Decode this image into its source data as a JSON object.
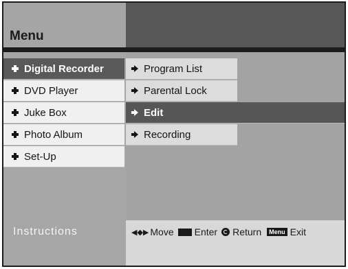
{
  "header": {
    "title": "Menu"
  },
  "main_menu": {
    "items": [
      {
        "label": "Digital Recorder",
        "selected": true
      },
      {
        "label": "DVD Player",
        "selected": false
      },
      {
        "label": "Juke Box",
        "selected": false
      },
      {
        "label": "Photo Album",
        "selected": false
      },
      {
        "label": "Set-Up",
        "selected": false
      }
    ]
  },
  "sub_menu": {
    "items": [
      {
        "label": "Program List",
        "selected": false
      },
      {
        "label": "Parental Lock",
        "selected": false
      },
      {
        "label": "Edit",
        "selected": true
      },
      {
        "label": "Recording",
        "selected": false
      }
    ]
  },
  "footer": {
    "title": "Instructions",
    "move_label": "Move",
    "enter_label": "Enter",
    "return_label": "Return",
    "menu_key_label": "Menu",
    "exit_label": "Exit"
  },
  "colors": {
    "header_light": "#a5a5a5",
    "header_dark": "#575757",
    "selected_bg": "#595959",
    "item_bg": "#f0f0f0",
    "subitem_bg": "#dcdcdc"
  },
  "icons": {
    "main_item": "cross-icon",
    "sub_item": "right-arrow-icon",
    "enter": "enter-key-icon",
    "return": "return-key-icon"
  }
}
